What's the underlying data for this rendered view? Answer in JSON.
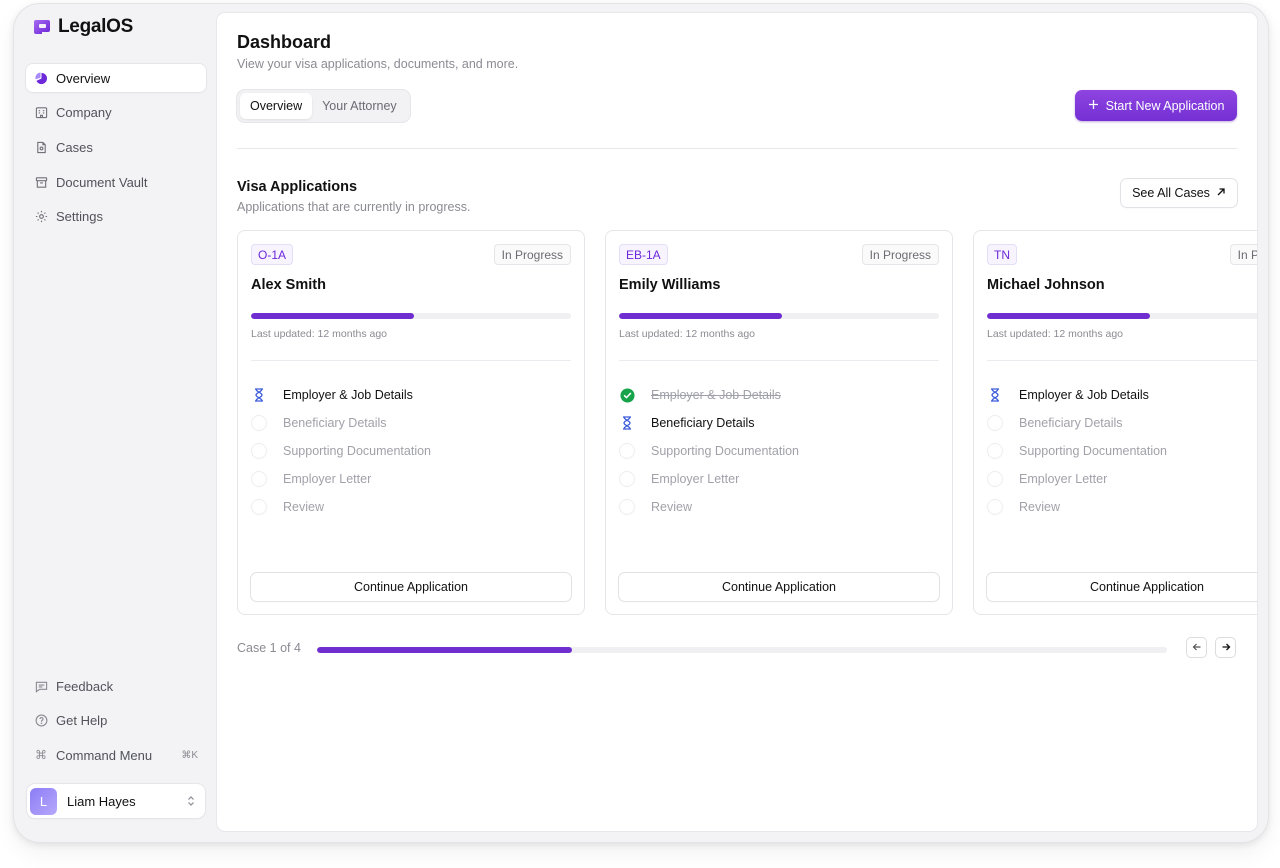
{
  "app": {
    "name": "LegalOS",
    "brand_color": "#7530d4"
  },
  "sidebar": {
    "nav": [
      {
        "label": "Overview",
        "icon": "overview-icon",
        "active": true
      },
      {
        "label": "Company",
        "icon": "building-icon"
      },
      {
        "label": "Cases",
        "icon": "file-icon"
      },
      {
        "label": "Document Vault",
        "icon": "archive-icon"
      },
      {
        "label": "Settings",
        "icon": "gear-icon"
      }
    ],
    "bottom": [
      {
        "label": "Feedback",
        "icon": "message-icon"
      },
      {
        "label": "Get Help",
        "icon": "help-circle-icon"
      },
      {
        "label": "Command Menu",
        "icon": "command-icon",
        "shortcut": "⌘K"
      }
    ],
    "user": {
      "initial": "L",
      "name": "Liam Hayes"
    }
  },
  "header": {
    "title": "Dashboard",
    "subtitle": "View your visa applications, documents, and more.",
    "tabs": [
      {
        "label": "Overview",
        "active": true
      },
      {
        "label": "Your Attorney"
      }
    ],
    "primary_action": "Start New Application"
  },
  "visa": {
    "title": "Visa Applications",
    "subtitle": "Applications that are currently in progress.",
    "see_all": "See All Cases",
    "continue_label": "Continue Application",
    "cards": [
      {
        "visa": "O-1A",
        "status": "In Progress",
        "name": "Alex Smith",
        "progress": 0.51,
        "updated": "Last updated: 12 months ago",
        "steps": [
          {
            "label": "Employer & Job Details",
            "state": "current"
          },
          {
            "label": "Beneficiary Details",
            "state": "pending"
          },
          {
            "label": "Supporting Documentation",
            "state": "pending"
          },
          {
            "label": "Employer Letter",
            "state": "pending"
          },
          {
            "label": "Review",
            "state": "pending"
          }
        ]
      },
      {
        "visa": "EB-1A",
        "status": "In Progress",
        "name": "Emily Williams",
        "progress": 0.51,
        "updated": "Last updated: 12 months ago",
        "steps": [
          {
            "label": "Employer & Job Details",
            "state": "done"
          },
          {
            "label": "Beneficiary Details",
            "state": "current"
          },
          {
            "label": "Supporting Documentation",
            "state": "pending"
          },
          {
            "label": "Employer Letter",
            "state": "pending"
          },
          {
            "label": "Review",
            "state": "pending"
          }
        ]
      },
      {
        "visa": "TN",
        "status": "In Progress",
        "name": "Michael Johnson",
        "progress": 0.51,
        "updated": "Last updated: 12 months ago",
        "steps": [
          {
            "label": "Employer & Job Details",
            "state": "current"
          },
          {
            "label": "Beneficiary Details",
            "state": "pending"
          },
          {
            "label": "Supporting Documentation",
            "state": "pending"
          },
          {
            "label": "Employer Letter",
            "state": "pending"
          },
          {
            "label": "Review",
            "state": "pending"
          }
        ]
      }
    ],
    "pager": {
      "label": "Case 1 of 4",
      "progress": 0.3
    }
  },
  "colors": {
    "done": "#16a34a",
    "current": "#3b5bdb",
    "accent": "#6f2fd0"
  }
}
